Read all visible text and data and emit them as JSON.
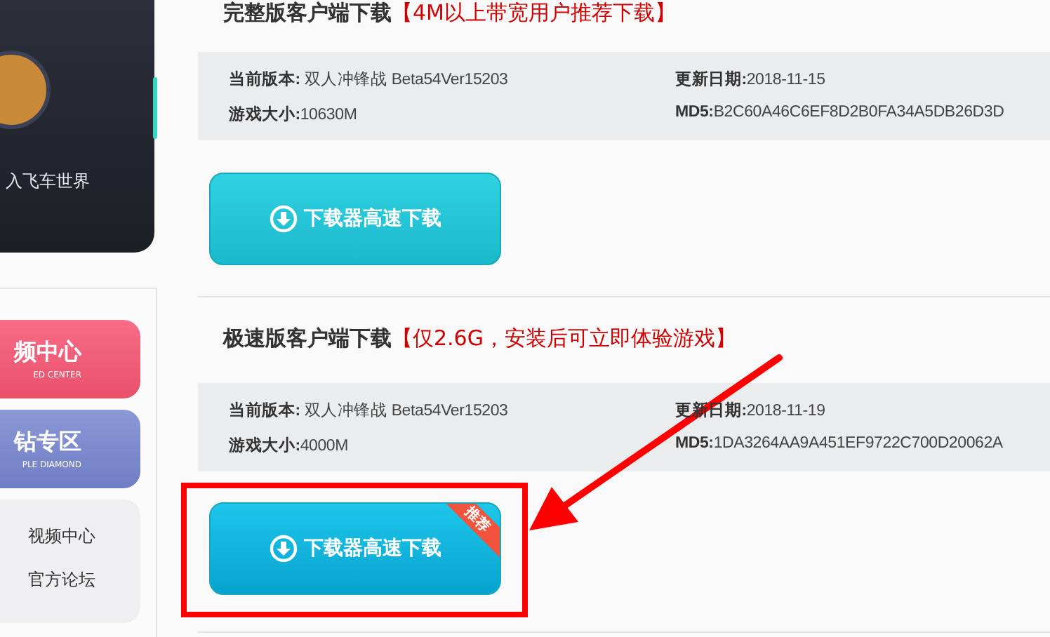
{
  "sidebar": {
    "profile_caption": "入飞车世界",
    "feature_buttons": [
      {
        "kind": "pink",
        "title": "频中心",
        "subtitle": "ED CENTER"
      },
      {
        "kind": "purple",
        "title": "钻专区",
        "subtitle": "PLE DIAMOND"
      }
    ],
    "links": [
      "视频中心",
      "官方论坛"
    ]
  },
  "sections": [
    {
      "title": "完整版客户端下载",
      "note": "【4M以上带宽用户推荐下载】",
      "version_label": "当前版本:",
      "version": " 双人冲锋战 Beta54Ver15203",
      "date_label": "更新日期:",
      "date": "2018-11-15",
      "size_label": "游戏大小:",
      "size": "10630M",
      "md5_label": "MD5:",
      "md5": "B2C60A46C6EF8D2B0FA34A5DB26D3D",
      "button": "下载器高速下载",
      "kind": "teal",
      "highlighted": false
    },
    {
      "title": "极速版客户端下载",
      "note": "【仅2.6G，安装后可立即体验游戏】",
      "version_label": "当前版本:",
      "version": " 双人冲锋战 Beta54Ver15203",
      "date_label": "更新日期:",
      "date": "2018-11-19",
      "size_label": "游戏大小:",
      "size": "4000M",
      "md5_label": "MD5:",
      "md5": "1DA3264AA9A451EF9722C700D20062A",
      "button": "下载器高速下载",
      "badge": "推荐",
      "kind": "blue",
      "highlighted": true
    }
  ]
}
